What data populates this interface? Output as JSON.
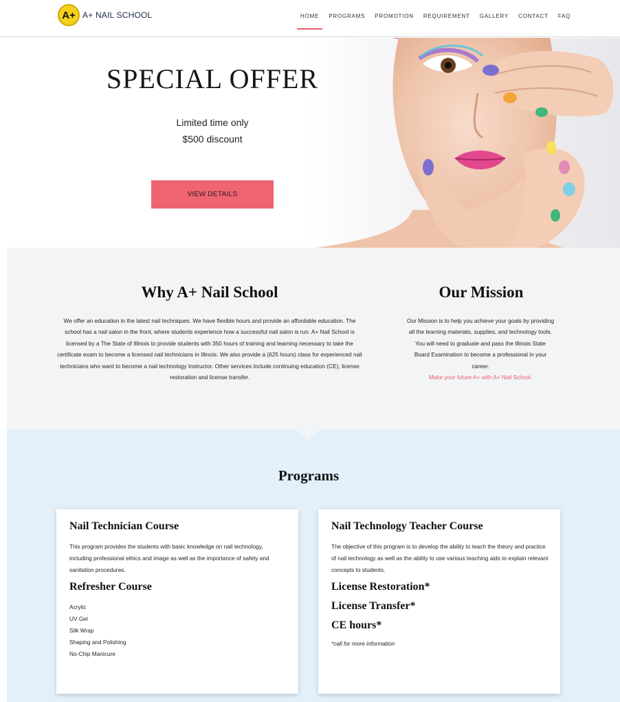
{
  "brand": {
    "logo_mark": "A+",
    "name": "A+ NAIL SCHOOL"
  },
  "nav": {
    "items": [
      {
        "label": "HOME",
        "active": true
      },
      {
        "label": "PROGRAMS",
        "active": false
      },
      {
        "label": "PROMOTION",
        "active": false
      },
      {
        "label": "REQUIREMENT",
        "active": false
      },
      {
        "label": "GALLERY",
        "active": false
      },
      {
        "label": "CONTACT",
        "active": false
      },
      {
        "label": "FAQ",
        "active": false
      }
    ]
  },
  "hero": {
    "title": "SPECIAL OFFER",
    "line1": "Limited time only",
    "line2": "$500 discount",
    "button": "VIEW DETAILS"
  },
  "why": {
    "title": "Why A+ Nail School",
    "body": "We offer an education in the latest nail techniques. We have flexible hours and provide an affordable education. The school has a nail salon in the front, where students experience how a successful nail salon is run. A+ Nail School is licensed by a The State of Illinois to provide students with 350 hours of training and learning necessary to take the certificate exam to become a licensed nail technicians in Illinois. We also provide a (625 hours) class for experienced nail technicians who want to become a nail technology Instructor. Other services include continuing education (CE), license restoration and license transfer."
  },
  "mission": {
    "title": "Our Mission",
    "body": "Our Mission is to help you achieve your goals by providing all the learning materials, supplies, and technology tools. You will need to graduate and pass the Illinois State Board Examination to become a professional in your career.",
    "tagline": "Make your future A+ with A+ Nail School."
  },
  "programs": {
    "title": "Programs",
    "left": {
      "heading1": "Nail Technician Course",
      "text1": "This program provides the students with basic knowledge on nail technology, including professional ethics and image as well as the importance of safety and sanitation procedures.",
      "heading2": "Refresher Course",
      "list": [
        "Acrylic",
        "UV Gel",
        "Silk Wrap",
        "Shaping and Polishing",
        "No-Chip Manicure"
      ]
    },
    "right": {
      "heading1": "Nail Technology Teacher Course",
      "text1": "The objective of this program is to develop the ability to teach the theory and practice of nail technology as well as the ability to use various teaching aids to explain relevant concepts to students.",
      "heading2": "License Restoration*",
      "heading3": "License Transfer*",
      "heading4": "CE hours*",
      "note": "*call for more information"
    }
  },
  "colors": {
    "accent": "#ee6472",
    "link_pink": "#e85c6a",
    "about_bg": "#f3f4f6",
    "programs_bg": "#e3f0fa",
    "logo_yellow": "#f4d11f"
  }
}
